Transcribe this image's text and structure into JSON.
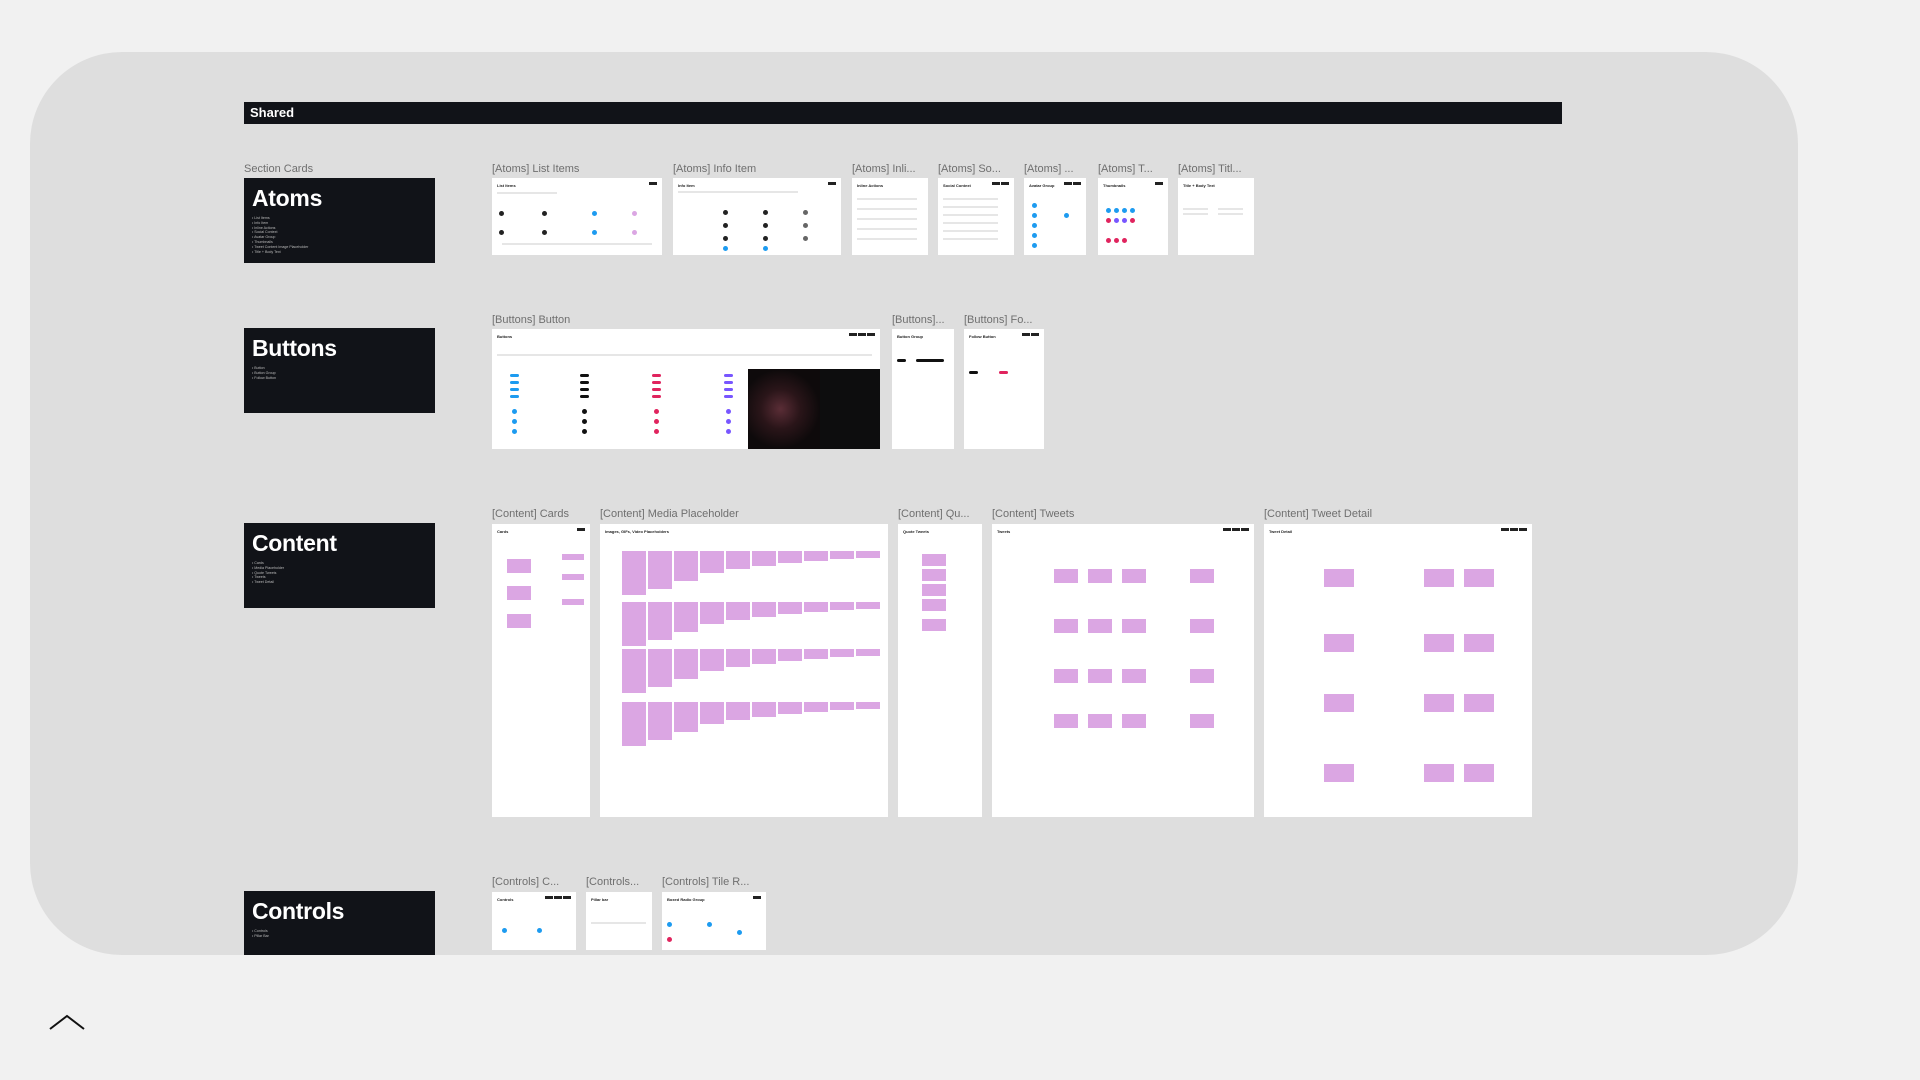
{
  "shared": {
    "title": "Shared"
  },
  "sections_label": "Section Cards",
  "sections": {
    "atoms": {
      "title": "Atoms",
      "items": [
        "List Items",
        "Info Item",
        "Inline Actions",
        "Social Context",
        "Avatar Group",
        "Thumbnails",
        "Tweet Content Image Placeholder",
        "Title + Body Text"
      ]
    },
    "buttons": {
      "title": "Buttons",
      "items": [
        "Button",
        "Button Group",
        "Follow Button"
      ]
    },
    "content": {
      "title": "Content",
      "items": [
        "Cards",
        "Media Placeholder",
        "Quote Tweets",
        "Tweets",
        "Tweet Detail"
      ]
    },
    "controls": {
      "title": "Controls",
      "items": [
        "Controls",
        "Pillar Bar"
      ]
    }
  },
  "frames": {
    "list_items": {
      "label": "[Atoms] List Items",
      "title": "List Items"
    },
    "info_item": {
      "label": "[Atoms] Info Item",
      "title": "Info Item"
    },
    "inline": {
      "label": "[Atoms] Inli...",
      "title": "Inline Actions"
    },
    "social": {
      "label": "[Atoms] So...",
      "title": "Social Context"
    },
    "avatar": {
      "label": "[Atoms] ...",
      "title": "Avatar Group"
    },
    "thumbs": {
      "label": "[Atoms] T...",
      "title": "Thumbnails"
    },
    "title_body": {
      "label": "[Atoms] Titl...",
      "title": "Title + Body Text"
    },
    "button": {
      "label": "[Buttons] Button",
      "title": "Buttons"
    },
    "button_group": {
      "label": "[Buttons]...",
      "title": "Button Group"
    },
    "follow": {
      "label": "[Buttons] Fo...",
      "title": "Follow Button"
    },
    "cards": {
      "label": "[Content] Cards",
      "title": "Cards"
    },
    "media": {
      "label": "[Content] Media Placeholder",
      "title": "Images, GIFs, Video Placeholders"
    },
    "quote": {
      "label": "[Content] Qu...",
      "title": "Quote Tweets"
    },
    "tweets": {
      "label": "[Content] Tweets",
      "title": "Tweets"
    },
    "tweet_detail": {
      "label": "[Content] Tweet Detail",
      "title": "Tweet Detail"
    },
    "controls": {
      "label": "[Controls] C...",
      "title": "Controls"
    },
    "pillar": {
      "label": "[Controls...",
      "title": "Pillar bar"
    },
    "tile": {
      "label": "[Controls] Tile R...",
      "title": "Boxed Radio Group"
    }
  },
  "colors": {
    "canvas": "#dedede",
    "dark": "#111318",
    "pink": "#dba6e3",
    "blue": "#1d9bf0",
    "red": "#e0245e",
    "purple": "#7856ff"
  },
  "icons": {
    "scroll_up": "chevron-up-icon"
  }
}
